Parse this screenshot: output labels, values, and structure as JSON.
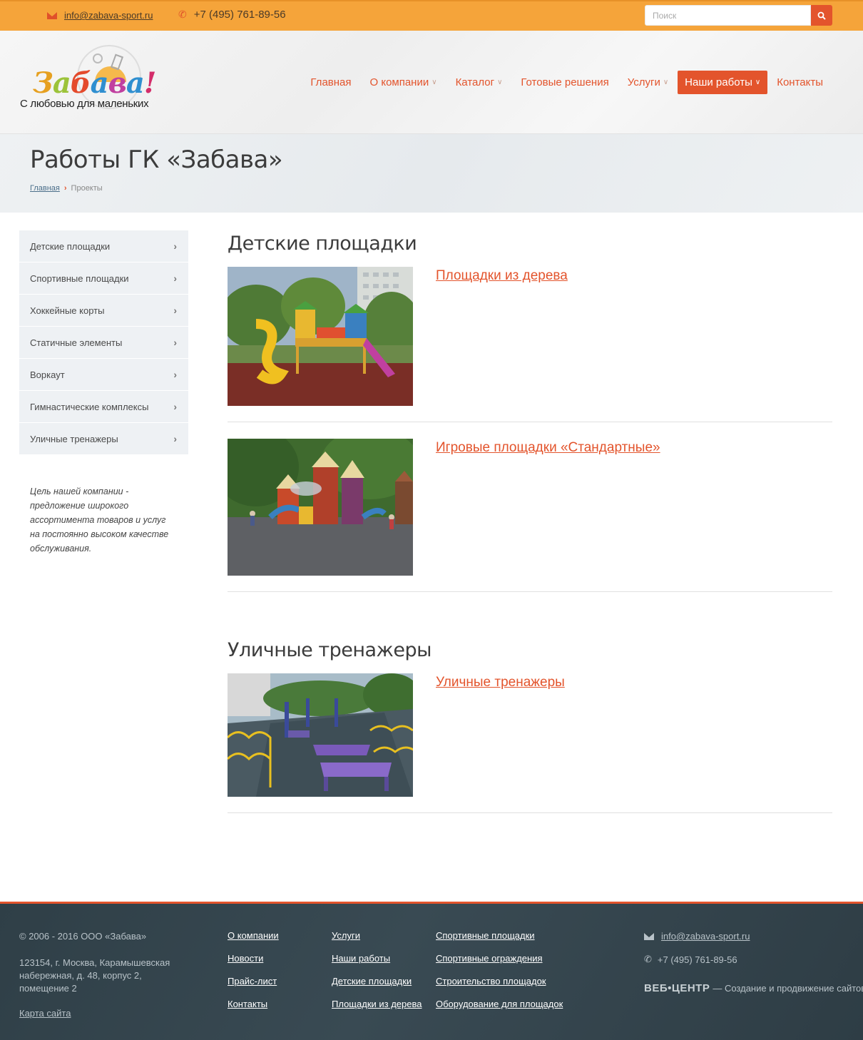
{
  "topbar": {
    "email": "info@zabava-sport.ru",
    "phone": "+7 (495) 761-89-56",
    "search_placeholder": "Поиск"
  },
  "logo": {
    "word": "Забава!",
    "tagline": "С любовью для маленьких"
  },
  "nav": [
    {
      "label": "Главная",
      "dropdown": false
    },
    {
      "label": "О компании",
      "dropdown": true
    },
    {
      "label": "Каталог",
      "dropdown": true
    },
    {
      "label": "Готовые решения",
      "dropdown": false
    },
    {
      "label": "Услуги",
      "dropdown": true
    },
    {
      "label": "Наши работы",
      "dropdown": true,
      "active": true
    },
    {
      "label": "Контакты",
      "dropdown": false
    }
  ],
  "page": {
    "title": "Работы ГК «Забава»",
    "breadcrumb_home": "Главная",
    "breadcrumb_current": "Проекты"
  },
  "sidebar": {
    "items": [
      "Детские площадки",
      "Спортивные площадки",
      "Хоккейные корты",
      "Статичные элементы",
      "Воркаут",
      "Гимнастические комплексы",
      "Уличные тренажеры"
    ],
    "quote": "Цель нашей компании - предложение широкого ассортимента товаров и услуг на постоянно высоком качестве обслуживания."
  },
  "sections": [
    {
      "title": "Детские площадки",
      "projects": [
        {
          "link": "Площадки из дерева"
        },
        {
          "link": "Игровые площадки «Стандартные»"
        }
      ]
    },
    {
      "title": "Уличные тренажеры",
      "projects": [
        {
          "link": "Уличные тренажеры"
        }
      ]
    }
  ],
  "footer": {
    "copyright": "© 2006 - 2016 ООО «Забава»",
    "address": "123154, г. Москва, Карамышевская набережная, д. 48, корпус 2, помещение 2",
    "sitemap": "Карта сайта",
    "col1": [
      "О компании",
      "Новости",
      "Прайс-лист",
      "Контакты"
    ],
    "col2": [
      "Услуги",
      "Наши работы",
      "Детские площадки",
      "Площадки из дерева"
    ],
    "col3": [
      "Спортивные площадки",
      "Спортивные ограждения",
      "Строительство площадок",
      "Оборудование для площадок"
    ],
    "email": "info@zabava-sport.ru",
    "phone": "+7 (495) 761-89-56",
    "dev_brand": "ВЕБ•ЦЕНТР",
    "dev_text": "— Создание и продвижение сайтов"
  },
  "colors": {
    "accent": "#e3542c",
    "topbar": "#f5a43a",
    "footer": "#334249"
  }
}
